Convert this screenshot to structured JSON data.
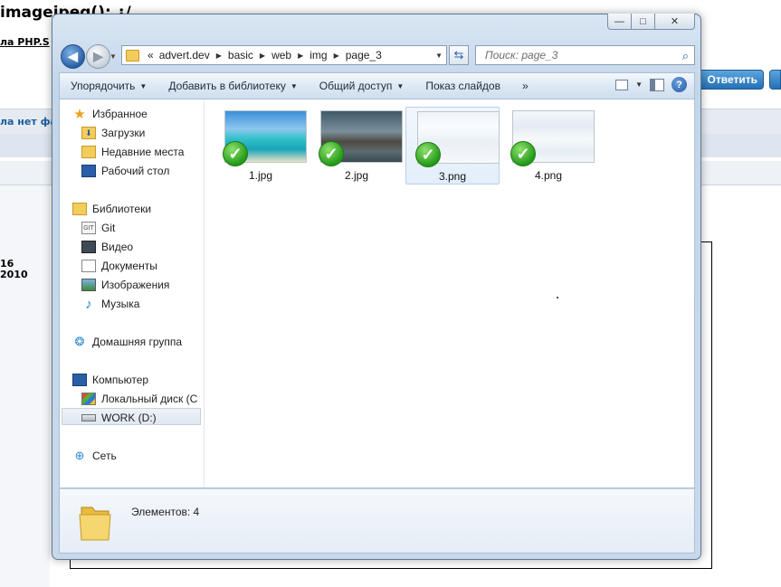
{
  "background_page": {
    "title": "imagejpeg(): ¿/",
    "subtitle": "ла PHP.S",
    "band_text": "ла нет фай",
    "reply_button": "Ответить",
    "left_values": [
      "16",
      "2010"
    ]
  },
  "window": {
    "controls": {
      "minimize": "—",
      "maximize": "□",
      "close": "✕"
    },
    "address": {
      "prefix": "«",
      "segments": [
        "advert.dev",
        "basic",
        "web",
        "img",
        "page_3"
      ]
    },
    "search": {
      "placeholder": "Поиск: page_3"
    },
    "toolbar": {
      "organize": "Упорядочить",
      "add_to_library": "Добавить в библиотеку",
      "share": "Общий доступ",
      "slideshow": "Показ слайдов",
      "more": "»",
      "help": "?"
    },
    "nav": {
      "favorites": "Избранное",
      "downloads": "Загрузки",
      "recent": "Недавние места",
      "desktop": "Рабочий стол",
      "libraries": "Библиотеки",
      "git": "Git",
      "video": "Видео",
      "documents": "Документы",
      "images": "Изображения",
      "music": "Музыка",
      "homegroup": "Домашняя группа",
      "computer": "Компьютер",
      "local_disk": "Локальный диск (C",
      "work": "WORK (D:)",
      "network": "Сеть"
    },
    "files": [
      {
        "name": "1.jpg"
      },
      {
        "name": "2.jpg"
      },
      {
        "name": "3.png",
        "selected": true
      },
      {
        "name": "4.png"
      }
    ],
    "status": {
      "count": "Элементов: 4"
    }
  },
  "colors": {
    "accent": "#2a5fa8",
    "check": "#249a19",
    "folder": "#f2cd5c"
  }
}
